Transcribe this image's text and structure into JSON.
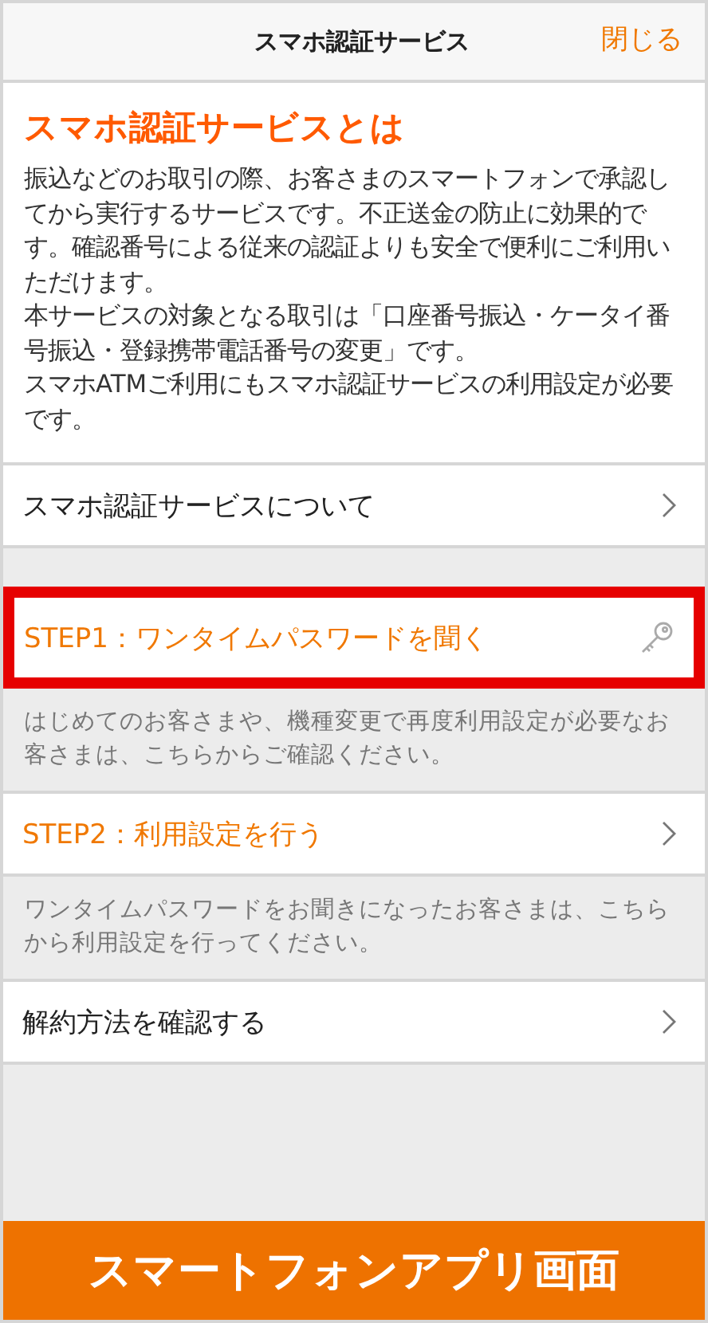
{
  "header": {
    "title": "スマホ認証サービス",
    "close": "閉じる"
  },
  "intro": {
    "heading": "スマホ認証サービスとは",
    "paragraphs": [
      "振込などのお取引の際、お客さまのスマートフォンで承認してから実行するサービスです。不正送金の防止に効果的です。確認番号による従来の認証よりも安全で便利にご利用いただけます。",
      "本サービスの対象となる取引は「口座番号振込・ケータイ番号振込・登録携帯電話番号の変更」です。",
      "スマホATMご利用にもスマホ認証サービスの利用設定が必要です。"
    ]
  },
  "sections": [
    [
      {
        "label": "スマホ認証サービスについて",
        "accent": false,
        "kind": "link",
        "highlighted": false
      }
    ],
    [
      {
        "label": "STEP1：ワンタイムパスワードを聞く",
        "accent": true,
        "kind": "key",
        "highlighted": true,
        "note": "はじめてのお客さまや、機種変更で再度利用設定が必要なお客さまは、こちらからご確認ください。"
      },
      {
        "label": "STEP2：利用設定を行う",
        "accent": true,
        "kind": "link",
        "highlighted": false,
        "note": "ワンタイムパスワードをお聞きになったお客さまは、こちらから利用設定を行ってください。"
      },
      {
        "label": "解約方法を確認する",
        "accent": false,
        "kind": "link",
        "highlighted": false
      }
    ]
  ],
  "banner": "スマートフォンアプリ画面"
}
